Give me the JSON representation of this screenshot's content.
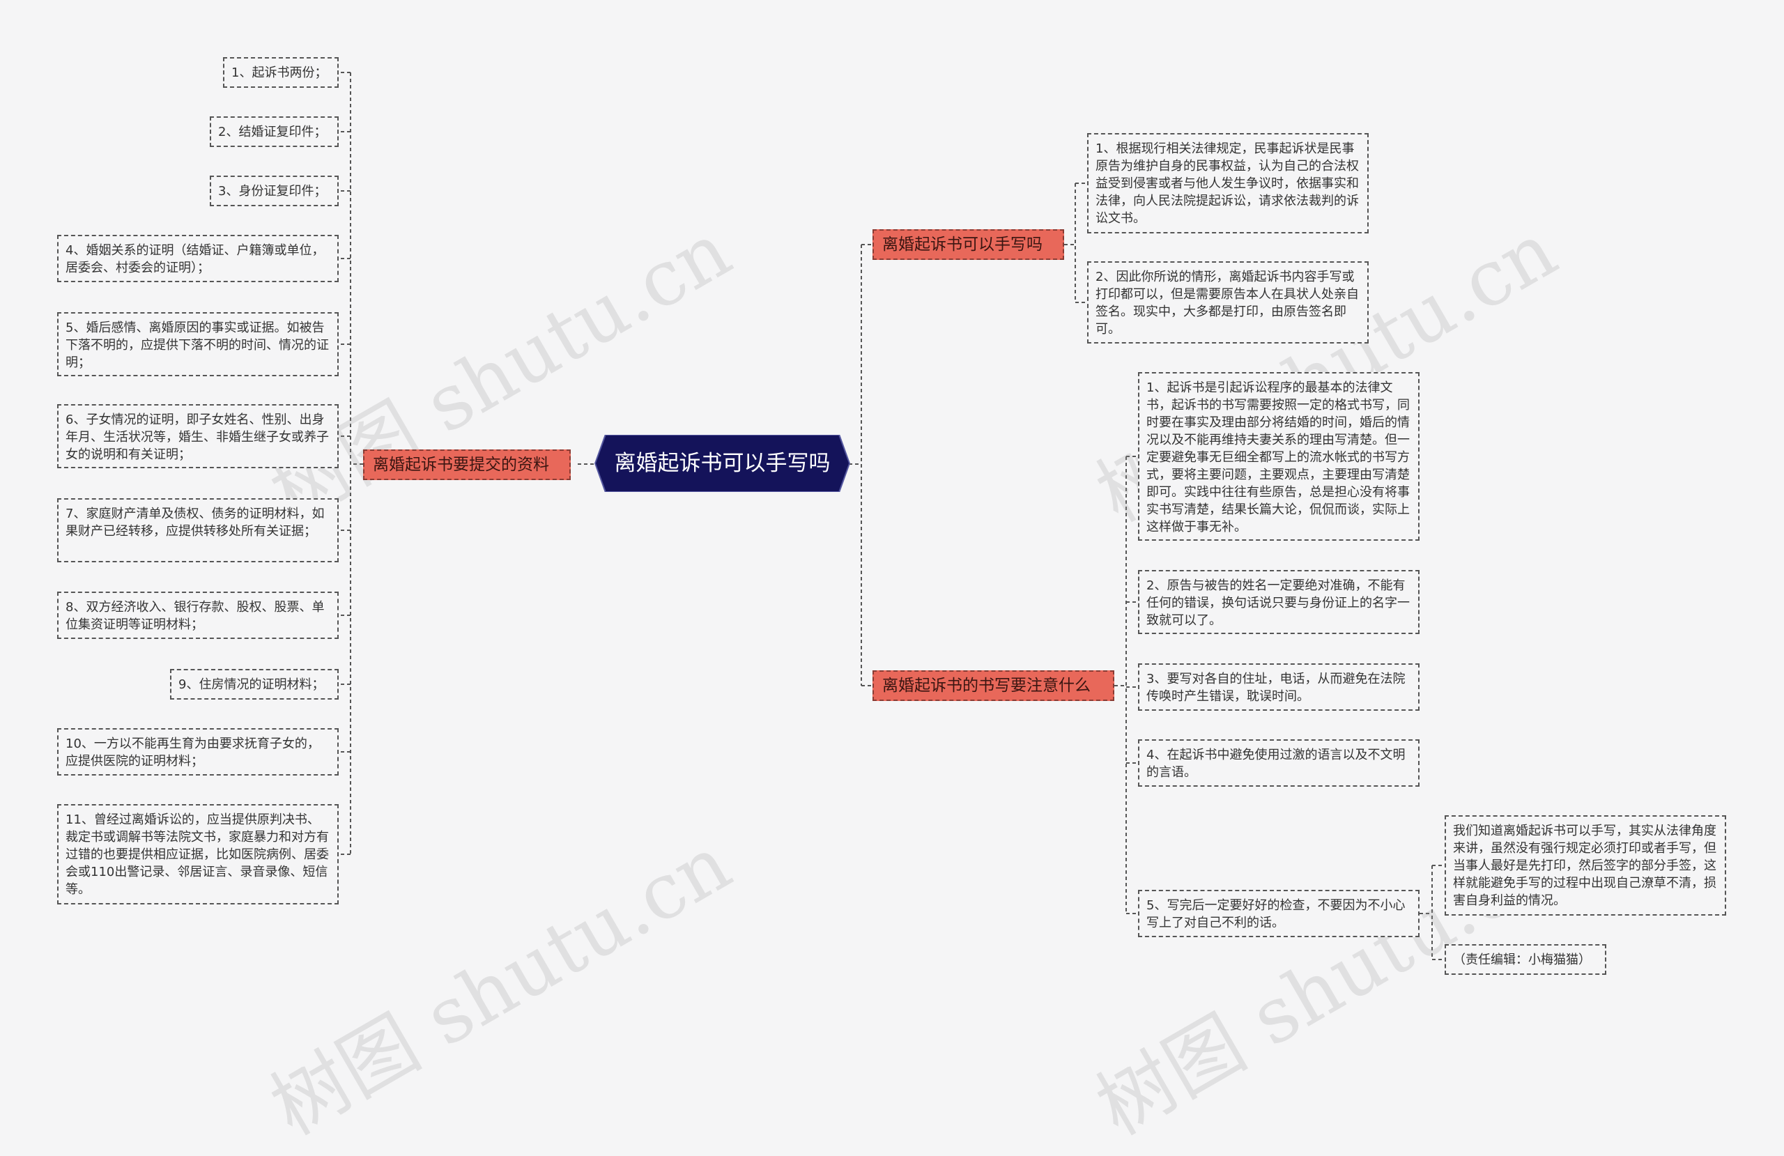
{
  "root": {
    "label": "离婚起诉书可以手写吗"
  },
  "branches": {
    "materials": {
      "label": "离婚起诉书要提交的资料",
      "items": [
        "1、起诉书两份；",
        "2、结婚证复印件；",
        "3、身份证复印件；",
        "4、婚姻关系的证明（结婚证、户籍簿或单位，居委会、村委会的证明）；",
        "5、婚后感情、离婚原因的事实或证据。如被告下落不明的，应提供下落不明的时间、情况的证明；",
        "6、子女情况的证明，即子女姓名、性别、出身年月、生活状况等，婚生、非婚生继子女或养子女的说明和有关证明；",
        "7、家庭财产清单及债权、债务的证明材料，如果财产已经转移，应提供转移处所有关证据；",
        "8、双方经济收入、银行存款、股权、股票、单位集资证明等证明材料；",
        "9、住房情况的证明材料；",
        "10、一方以不能再生育为由要求抚育子女的，应提供医院的证明材料；",
        "11、曾经过离婚诉讼的，应当提供原判决书、裁定书或调解书等法院文书，家庭暴力和对方有过错的也要提供相应证据，比如医院病例、居委会或110出警记录、邻居证言、录音录像、短信等。"
      ]
    },
    "handwrite": {
      "label": "离婚起诉书可以手写吗",
      "items": [
        "1、根据现行相关法律规定，民事起诉状是民事原告为维护自身的民事权益，认为自己的合法权益受到侵害或者与他人发生争议时，依据事实和法律，向人民法院提起诉讼，请求依法裁判的诉讼文书。",
        "2、因此你所说的情形，离婚起诉书内容手写或打印都可以，但是需要原告本人在具状人处亲自签名。现实中，大多都是打印，由原告签名即可。"
      ]
    },
    "notes": {
      "label": "离婚起诉书的书写要注意什么",
      "items": [
        "1、起诉书是引起诉讼程序的最基本的法律文书，起诉书的书写需要按照一定的格式书写，同时要在事实及理由部分将结婚的时间，婚后的情况以及不能再维持夫妻关系的理由写清楚。但一定要避免事无巨细全都写上的流水帐式的书写方式，要将主要问题，主要观点，主要理由写清楚即可。实践中往往有些原告，总是担心没有将事实书写清楚，结果长篇大论，侃侃而谈，实际上这样做于事无补。",
        "2、原告与被告的姓名一定要绝对准确，不能有任何的错误，换句话说只要与身份证上的名字一致就可以了。",
        "3、要写对各自的住址，电话，从而避免在法院传唤时产生错误，耽误时间。",
        "4、在起诉书中避免使用过激的语言以及不文明的言语。",
        "5、写完后一定要好好的检查，不要因为不小心写上了对自己不利的话。"
      ],
      "sub_items": [
        "我们知道离婚起诉书可以手写，其实从法律角度来讲，虽然没有强行规定必须打印或者手写，但当事人最好是先打印，然后签字的部分手签，这样就能避免手写的过程中出现自己潦草不清，损害自身利益的情况。",
        "（责任编辑：小梅猫猫）"
      ]
    }
  },
  "watermark": "树图 shutu.cn",
  "colors": {
    "root": "#14135a",
    "branch": "#e8685a",
    "background": "#f5f5f6",
    "line": "#555555"
  }
}
